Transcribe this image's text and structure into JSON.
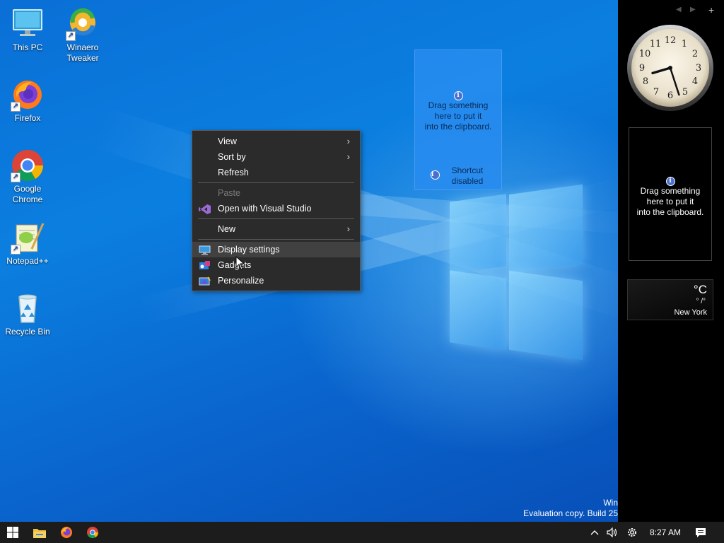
{
  "desktop": {
    "icons": [
      {
        "label": "This PC",
        "icon": "this-pc-icon"
      },
      {
        "label": "Winaero Tweaker",
        "icon": "winaero-tweaker-icon",
        "line1": "Winaero",
        "line2": "Tweaker"
      },
      {
        "label": "Firefox",
        "icon": "firefox-icon"
      },
      {
        "label": "Google Chrome",
        "icon": "chrome-icon",
        "line1": "Google",
        "line2": "Chrome"
      },
      {
        "label": "Notepad++",
        "icon": "notepad-plus-plus-icon"
      },
      {
        "label": "Recycle Bin",
        "icon": "recycle-bin-icon"
      }
    ],
    "clipboard_panel": {
      "line1": "Drag something",
      "line2": "here to put it",
      "line3": "into the clipboard.",
      "shortcut_line1": "Shortcut",
      "shortcut_line2": "disabled"
    },
    "watermark": {
      "line1": "Win",
      "line2": "Evaluation copy. Build 25"
    }
  },
  "context_menu": {
    "items": [
      {
        "label": "View",
        "submenu": true
      },
      {
        "label": "Sort by",
        "submenu": true
      },
      {
        "label": "Refresh"
      },
      {
        "label": "Paste",
        "disabled": true
      },
      {
        "label": "Open with Visual Studio",
        "icon": "visual-studio-icon"
      },
      {
        "label": "New",
        "submenu": true
      },
      {
        "label": "Display settings",
        "icon": "display-icon",
        "hovered": true
      },
      {
        "label": "Gadgets",
        "icon": "gadgets-icon"
      },
      {
        "label": "Personalize",
        "icon": "personalize-icon"
      }
    ]
  },
  "sidebar": {
    "controls": {
      "prev": "◀",
      "next": "▶",
      "add": "+"
    },
    "clock": {
      "hour": 8,
      "minute": 27
    },
    "clipboard": {
      "line1": "Drag something",
      "line2": "here to put it",
      "line3": "into the clipboard."
    },
    "weather": {
      "unit": "°C",
      "temp_range": "° /°",
      "city": "New York"
    }
  },
  "taskbar": {
    "apps": [
      "start-icon",
      "file-explorer-icon",
      "firefox-icon",
      "chrome-icon"
    ],
    "tray": {
      "time": "8:27 AM"
    }
  },
  "colors": {
    "menu_bg": "#2b2b2b",
    "menu_hover": "#414141",
    "taskbar": "#1c1c1c",
    "sidebar": "#000000"
  }
}
